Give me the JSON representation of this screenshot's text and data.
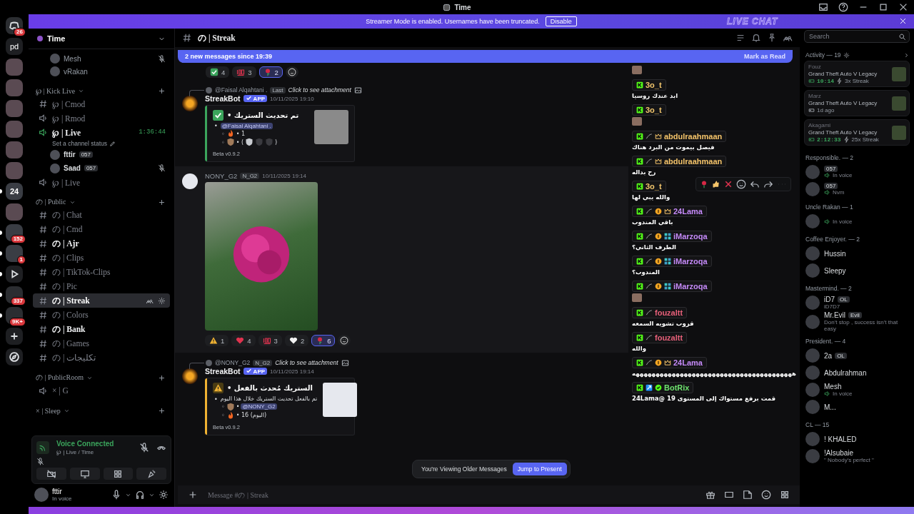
{
  "titlebar": {
    "title": "Time"
  },
  "banner": {
    "text": "Streamer Mode is enabled. Usernames have been truncated.",
    "button": "Disable",
    "logo": "LIVE CHAT"
  },
  "servers": [
    {
      "kind": "home",
      "badge": "26",
      "unread": false
    },
    {
      "kind": "text",
      "label": "pd",
      "unread": false
    },
    {
      "kind": "avatar",
      "unread": false
    },
    {
      "kind": "avatar",
      "unread": false
    },
    {
      "kind": "avatar",
      "unread": false
    },
    {
      "kind": "avatar",
      "unread": false
    },
    {
      "kind": "avatar",
      "unread": false
    },
    {
      "kind": "avatar",
      "unread": false
    },
    {
      "kind": "avatar",
      "label": "24",
      "unread": true
    },
    {
      "kind": "avatar",
      "unread": false
    },
    {
      "kind": "avatar",
      "badge": "152",
      "unread": true
    },
    {
      "kind": "avatar",
      "badge": "1",
      "unread": true
    },
    {
      "kind": "play",
      "unread": true
    },
    {
      "kind": "folder",
      "badge": "337",
      "unread": true
    },
    {
      "kind": "folder",
      "badge": "9K+",
      "unread": true
    },
    {
      "kind": "add",
      "unread": false
    },
    {
      "kind": "discover",
      "unread": false
    }
  ],
  "sidebar": {
    "server": "Time",
    "voice_users": [
      {
        "name": "Mesh",
        "muted": true
      },
      {
        "name": "vRakan",
        "muted": false
      }
    ],
    "categories": [
      {
        "name": "℘ | Kick Live",
        "channels": [
          {
            "kind": "text",
            "name": "℘ | Cmod",
            "unread": false,
            "selected": false
          },
          {
            "kind": "voice",
            "name": "℘ | Rmod",
            "unread": false,
            "selected": false,
            "active": false
          },
          {
            "kind": "voice",
            "name": "℘ | Live",
            "unread": true,
            "selected": false,
            "active": true,
            "timer": "1:36:44",
            "status": "Set a channel status",
            "users": [
              {
                "name": "fttir",
                "tag": "057",
                "muted": false
              },
              {
                "name": "Saad",
                "tag": "057",
                "muted": true
              }
            ]
          },
          {
            "kind": "voice",
            "name": "℘ | Live",
            "unread": false,
            "selected": false,
            "active": false
          }
        ]
      },
      {
        "name": "の | Public",
        "channels": [
          {
            "kind": "text",
            "name": "の | Chat",
            "unread": false,
            "selected": false
          },
          {
            "kind": "text",
            "name": "の | Cmd",
            "unread": false,
            "selected": false
          },
          {
            "kind": "text",
            "name": "の | Ajr",
            "unread": true,
            "selected": false
          },
          {
            "kind": "text",
            "name": "の | Clips",
            "unread": false,
            "selected": false
          },
          {
            "kind": "text",
            "name": "の | TikTok-Clips",
            "unread": false,
            "selected": false
          },
          {
            "kind": "text",
            "name": "の | Pic",
            "unread": false,
            "selected": false
          },
          {
            "kind": "text",
            "name": "の | Streak",
            "unread": true,
            "selected": true
          },
          {
            "kind": "text",
            "name": "の | Colors",
            "unread": false,
            "selected": false
          },
          {
            "kind": "text",
            "name": "の | Bank",
            "unread": true,
            "selected": false
          },
          {
            "kind": "text",
            "name": "の | Games",
            "unread": false,
            "selected": false
          },
          {
            "kind": "text",
            "name": "の | تكليجات",
            "unread": false,
            "selected": false
          }
        ]
      },
      {
        "name": "の | PublicRoom",
        "channels": [
          {
            "kind": "voice",
            "name": "× | G",
            "unread": false,
            "selected": false,
            "active": false
          }
        ]
      },
      {
        "name": "× | Sleep"
      }
    ],
    "voice_panel": {
      "title": "Voice Connected",
      "channel": "℘ | Live / Time"
    },
    "user": {
      "name": "fttir",
      "status": "In voice"
    }
  },
  "chat": {
    "channel": "の | Streak",
    "new_messages": "2 new messages since 19:39",
    "mark_read": "Mark as Read",
    "top_reactions": [
      {
        "kind": "check",
        "count": "4",
        "selected": false
      },
      {
        "kind": "hundred",
        "count": "3",
        "selected": false
      },
      {
        "kind": "rose",
        "count": "2",
        "selected": true
      }
    ],
    "messages": [
      {
        "kind": "bot",
        "reply": {
          "mention": "@Faisal Alqahtani .",
          "tag": "Last",
          "text": "Click to see attachment"
        },
        "author": "StreakBot",
        "badge": "APP",
        "time": "10/11/2025 19:10",
        "embed": {
          "color": "#3ba55c",
          "kind": "success",
          "title": "تم تحديث الستريك •",
          "lines": [
            {
              "marker": "•",
              "kind": "mention",
              "text": "@Faisal Alqahtani .",
              "children": [
                {
                  "marker": "◦",
                  "kind": "fire",
                  "text": "• 1"
                },
                {
                  "marker": "◦",
                  "kind": "shields",
                  "text": "• (",
                  "close": ")"
                }
              ]
            }
          ],
          "footer": "Beta v0.9.2"
        }
      },
      {
        "kind": "photo",
        "author": "NONY_G2",
        "tag": "N_G2",
        "time": "10/11/2025 19:14",
        "reactions": [
          {
            "kind": "warning",
            "count": "1",
            "selected": false
          },
          {
            "kind": "heart",
            "count": "4",
            "selected": false
          },
          {
            "kind": "hundred",
            "count": "3",
            "selected": false
          },
          {
            "kind": "white-heart",
            "count": "2",
            "selected": false
          },
          {
            "kind": "rose",
            "count": "6",
            "selected": true
          }
        ]
      },
      {
        "kind": "bot",
        "reply": {
          "mention": "@NONY_G2",
          "tag": "N_G2",
          "text": "Click to see attachment"
        },
        "author": "StreakBot",
        "badge": "APP",
        "time": "10/11/2025 19:14",
        "embed": {
          "color": "#f0b232",
          "kind": "warning",
          "title": "الستريك مُحدث بالفعل •",
          "lines": [
            {
              "marker": "•",
              "kind": "text",
              "text": "تم بالفعل تحديث الستريك خلال هذا اليوم",
              "children": [
                {
                  "marker": "◦",
                  "kind": "shield",
                  "text": "•",
                  "mention": "@NONY_G2"
                },
                {
                  "marker": "◦",
                  "kind": "fire",
                  "text": "• 16 (اليوم)"
                }
              ]
            }
          ],
          "footer": "Beta v0.9.2"
        }
      }
    ],
    "older_notice": "You're Viewing Older Messages",
    "jump": "Jump to Present",
    "placeholder": "Message #の | Streak"
  },
  "live_chat": {
    "messages": [
      {
        "kind": "emote",
        "hovered": false
      },
      {
        "user": "3o_t",
        "color": "#f2c66d",
        "badges": [
          {
            "kind": "kick"
          }
        ],
        "kind": "text",
        "text": "ابد عندك روسيا",
        "hovered": false
      },
      {
        "user": "3o_t",
        "color": "#f2c66d",
        "badges": [
          {
            "kind": "kick"
          }
        ],
        "kind": "emote",
        "hovered": false
      },
      {
        "user": "abdulraahmaan",
        "color": "#f5c46a",
        "badges": [
          {
            "kind": "kick"
          },
          {
            "kind": "sword"
          },
          {
            "kind": "crown"
          }
        ],
        "kind": "text",
        "text": "فيصل بيموت من البرد هناك",
        "hovered": false
      },
      {
        "user": "abdulraahmaan",
        "color": "#f5c46a",
        "badges": [
          {
            "kind": "kick"
          },
          {
            "kind": "sword"
          },
          {
            "kind": "crown"
          }
        ],
        "kind": "text",
        "text": "رح بداله",
        "hovered": false
      },
      {
        "user": "3o_t",
        "color": "#f2c66d",
        "badges": [
          {
            "kind": "kick"
          }
        ],
        "kind": "text",
        "text": "والله يبي لها",
        "hovered": true
      },
      {
        "user": "24Lama",
        "color": "#c58af9",
        "badges": [
          {
            "kind": "kick"
          },
          {
            "kind": "sword"
          },
          {
            "kind": "one"
          },
          {
            "kind": "crown"
          }
        ],
        "kind": "text",
        "text": "باقي المندوب",
        "hovered": false
      },
      {
        "user": "iMarzoqa",
        "color": "#c58af9",
        "badges": [
          {
            "kind": "kick"
          },
          {
            "kind": "sword"
          },
          {
            "kind": "one"
          },
          {
            "kind": "sub"
          }
        ],
        "kind": "text",
        "text": "الطرف الثاني؟",
        "hovered": false
      },
      {
        "user": "iMarzoqa",
        "color": "#c58af9",
        "badges": [
          {
            "kind": "kick"
          },
          {
            "kind": "sword"
          },
          {
            "kind": "one"
          },
          {
            "kind": "sub"
          }
        ],
        "kind": "text",
        "text": "المندوب؟",
        "hovered": false
      },
      {
        "user": "iMarzoqa",
        "color": "#c58af9",
        "badges": [
          {
            "kind": "kick"
          },
          {
            "kind": "sword"
          },
          {
            "kind": "one"
          },
          {
            "kind": "sub"
          }
        ],
        "kind": "emote",
        "hovered": false
      },
      {
        "user": "fouzaltt",
        "color": "#e8607a",
        "badges": [
          {
            "kind": "kick"
          },
          {
            "kind": "sword"
          }
        ],
        "kind": "text",
        "text": "قروب تشويه السمعه",
        "hovered": false
      },
      {
        "user": "fouzaltt",
        "color": "#e8607a",
        "badges": [
          {
            "kind": "kick"
          },
          {
            "kind": "sword"
          }
        ],
        "kind": "text",
        "text": "والله",
        "hovered": false
      },
      {
        "user": "24Lama",
        "color": "#c58af9",
        "badges": [
          {
            "kind": "kick"
          },
          {
            "kind": "sword"
          },
          {
            "kind": "one"
          },
          {
            "kind": "crown"
          }
        ],
        "kind": "text",
        "text": "ههههههههههههههههههههههههههههههههههههههههه",
        "hovered": false
      },
      {
        "user": "BotRix",
        "color": "#6ee26e",
        "badges": [
          {
            "kind": "kick"
          },
          {
            "kind": "mod"
          },
          {
            "kind": "verified"
          }
        ],
        "kind": "text",
        "text": "قمت برفع مستواك إلى المستوى 19 @24Lama",
        "hovered": false
      }
    ]
  },
  "members": {
    "search": {
      "placeholder": "Search"
    },
    "activity": {
      "title": "Activity — 19",
      "cards": [
        {
          "name": "Fouz",
          "game": "Grand Theft Auto V Legacy",
          "time": "10:14",
          "streak": "3x Streak",
          "playing": true
        },
        {
          "name": "Marz",
          "game": "Grand Theft Auto V Legacy",
          "time": "1d ago",
          "playing": false
        },
        {
          "name": "Akagami",
          "game": "Grand Theft Auto V Legacy",
          "time": "2:12:33",
          "streak": "25x Streak",
          "playing": true
        }
      ]
    },
    "groups": [
      {
        "title": "Responsible. — 2",
        "members": [
          {
            "tag": "057",
            "status": "In voice",
            "in_voice": true
          },
          {
            "tag": "057",
            "status": "Nvm",
            "in_voice": true
          }
        ]
      },
      {
        "title": "Uncle Rakan — 1",
        "members": [
          {
            "status": "In voice",
            "in_voice": true
          }
        ]
      },
      {
        "title": "Coffee Enjoyer. — 2",
        "members": [
          {
            "name": "Hussin"
          },
          {
            "name": "Sleepy"
          }
        ]
      },
      {
        "title": "Mastermind. — 2",
        "members": [
          {
            "name": "iD7",
            "tag": "OL",
            "status": "iD7D7",
            "in_voice": false
          },
          {
            "name": "Mr.Evil",
            "tag": "Evil",
            "status": "Don't stop , success isn't that easy",
            "in_voice": false
          }
        ]
      },
      {
        "title": "President. — 4",
        "members": [
          {
            "name": "2a",
            "tag": "OL"
          },
          {
            "name": "Abdulrahman"
          },
          {
            "name": "Mesh",
            "status": "In voice",
            "in_voice": true
          },
          {
            "name": "M..."
          }
        ]
      },
      {
        "title": "CL — 15",
        "members": [
          {
            "name": "! KHALED"
          },
          {
            "name": "!Alsubaie",
            "status": "\" Nobody's perfect \"",
            "in_voice": false
          }
        ]
      }
    ]
  }
}
